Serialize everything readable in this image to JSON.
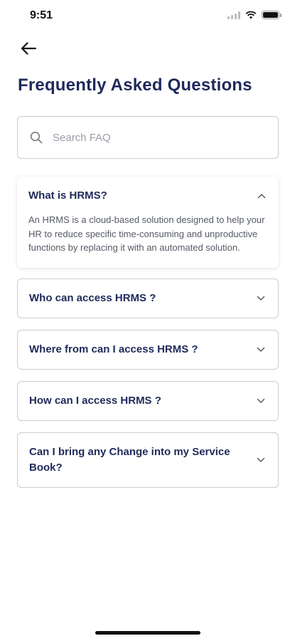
{
  "status": {
    "time": "9:51"
  },
  "header": {
    "title": "Frequently Asked Questions"
  },
  "search": {
    "placeholder": "Search FAQ",
    "value": ""
  },
  "faqs": [
    {
      "question": "What is HRMS?",
      "answer": "An HRMS is a cloud-based solution designed to help your HR to reduce specific time-consuming and unproductive functions by replacing it with an automated solution.",
      "expanded": true
    },
    {
      "question": "Who can access HRMS ?",
      "expanded": false
    },
    {
      "question": "Where from can I access HRMS ?",
      "expanded": false
    },
    {
      "question": "How can I access HRMS ?",
      "expanded": false
    },
    {
      "question": "Can I bring any Change into my Service Book?",
      "expanded": false
    }
  ],
  "colors": {
    "title": "#1f2a5a",
    "border": "#c9ccd4",
    "answer": "#555a66"
  },
  "icons": {
    "back": "arrow-left-icon",
    "search": "search-icon",
    "collapse": "chevron-up-icon",
    "expand": "chevron-down-icon"
  }
}
